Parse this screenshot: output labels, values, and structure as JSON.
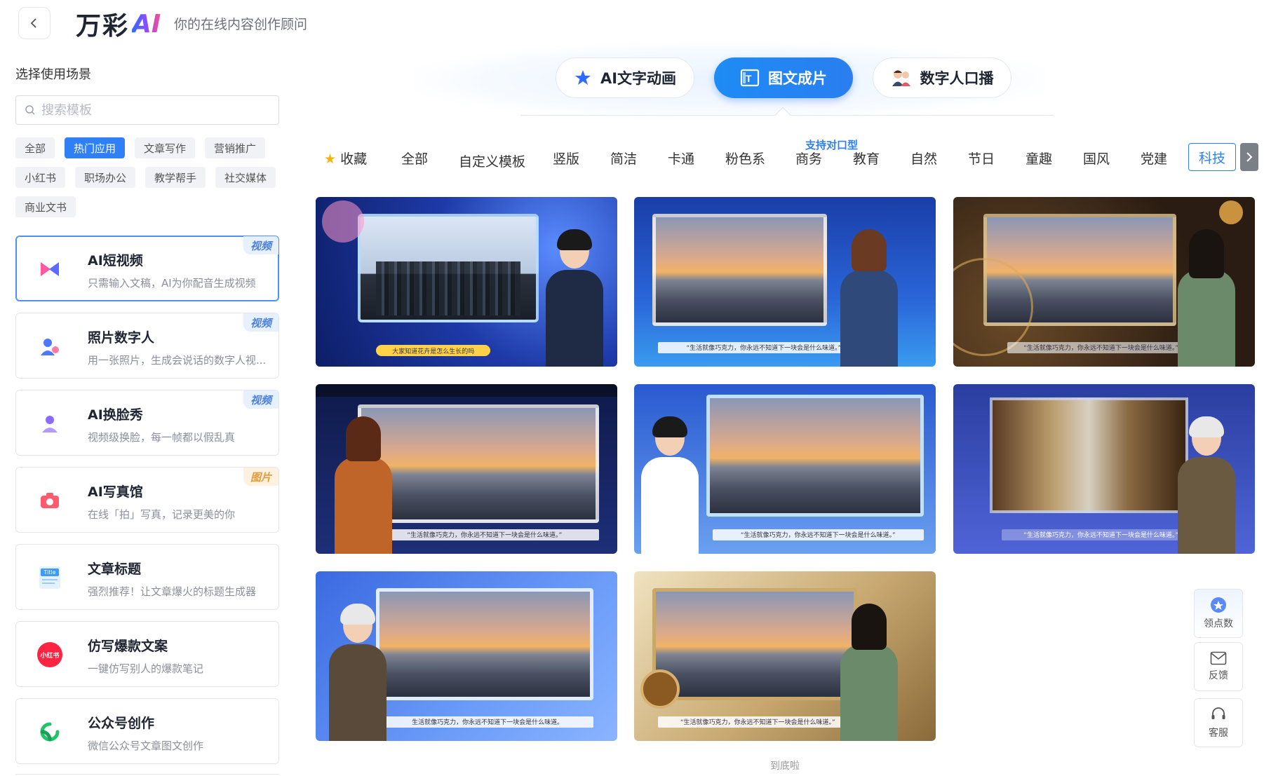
{
  "header": {
    "logo_cn": "万彩",
    "logo_ai": "AI",
    "tagline": "你的在线内容创作顾问"
  },
  "sidebar": {
    "section_title": "选择使用场景",
    "search_placeholder": "搜索模板",
    "tags": [
      "全部",
      "热门应用",
      "文章写作",
      "营销推广",
      "小红书",
      "职场办公",
      "教学帮手",
      "社交媒体",
      "商业文书"
    ],
    "active_tag": "热门应用",
    "cards": [
      {
        "title": "AI短视频",
        "desc": "只需输入文稿，AI为你配音生成视频",
        "badge": "视频",
        "icon": "video-play-icon"
      },
      {
        "title": "照片数字人",
        "desc": "用一张照片，生成会说话的数字人视...",
        "badge": "视频",
        "icon": "digital-person-icon"
      },
      {
        "title": "AI换脸秀",
        "desc": "视频级换脸，每一帧都以假乱真",
        "badge": "视频",
        "icon": "face-swap-icon"
      },
      {
        "title": "AI写真馆",
        "desc": "在线「拍」写真，记录更美的你",
        "badge": "图片",
        "icon": "camera-icon"
      },
      {
        "title": "文章标题",
        "desc": "强烈推荐！让文章爆火的标题生成器",
        "badge": "",
        "icon": "title-doc-icon"
      },
      {
        "title": "仿写爆款文案",
        "desc": "一键仿写别人的爆款笔记",
        "badge": "",
        "icon": "xiaohongshu-icon"
      },
      {
        "title": "公众号创作",
        "desc": "微信公众号文章图文创作",
        "badge": "",
        "icon": "wechat-official-icon"
      }
    ],
    "xhs_icon_text": "小红书",
    "title_icon_text": "Title"
  },
  "tabs": [
    {
      "label": "AI文字动画",
      "icon": "star-icon"
    },
    {
      "label": "图文成片",
      "icon": "image-text-icon"
    },
    {
      "label": "数字人口播",
      "icon": "avatar-pair-icon"
    }
  ],
  "active_tab": "图文成片",
  "categories": {
    "items": [
      "收藏",
      "全部",
      "自定义模板",
      "竖版",
      "简洁",
      "卡通",
      "粉色系",
      "商务",
      "教育",
      "自然",
      "节日",
      "童趣",
      "国风",
      "党建"
    ],
    "super_label": "支持对口型",
    "active": "科技"
  },
  "templates": [
    {
      "caption": "大家知道花卉是怎么生长的吗",
      "theme": "tech-city"
    },
    {
      "caption": "“生活就像巧克力，你永远不知道下一块会是什么味道。”",
      "theme": "blue-city-woman"
    },
    {
      "caption": "“生活就像巧克力，你永远不知道下一块会是什么味道。”",
      "theme": "gold-clock"
    },
    {
      "caption": "“生活就像巧克力，你永远不知道下一块会是什么味道。”",
      "theme": "stage-lights"
    },
    {
      "caption": "“生活就像巧克力，你永远不知道下一块会是什么味道。”",
      "theme": "blue-frame-man"
    },
    {
      "caption": "“生活就像巧克力，你永远不知道下一块会是什么味道。”",
      "theme": "library"
    },
    {
      "caption": "生活就像巧克力，你永远不知道下一块会是什么味道。",
      "theme": "molecule"
    },
    {
      "caption": "“生活就像巧克力，你永远不知道下一块会是什么味道。”",
      "theme": "gold-film"
    }
  ],
  "float": {
    "points": "领点数",
    "feedback": "反馈",
    "service": "客服"
  },
  "footer_text": "到底啦",
  "colors": {
    "accent": "#2f80f6",
    "badge_video": "#4a7fe0",
    "badge_image": "#e59a3a"
  }
}
